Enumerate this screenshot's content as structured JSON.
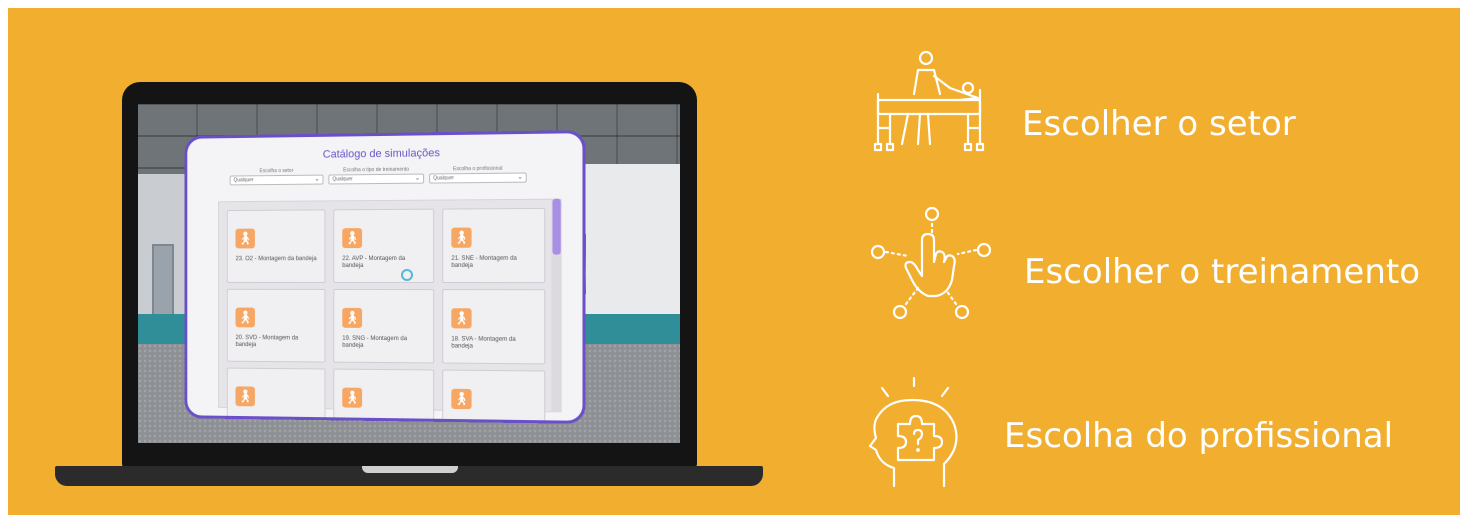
{
  "colors": {
    "background": "#f2ae2e",
    "accent_purple": "#6a4fc9",
    "card_icon": "#f7a764",
    "laptop": "#141414"
  },
  "catalog": {
    "title": "Catálogo de simulações",
    "filters": [
      {
        "label": "Escolha o setor",
        "value": "Qualquer"
      },
      {
        "label": "Escolha o tipo de treinamento",
        "value": "Qualquer"
      },
      {
        "label": "Escolha o profissional",
        "value": "Qualquer"
      }
    ],
    "cards": [
      {
        "label": "23. O2 - Montagem da bandeja",
        "icon": "walking-person-icon"
      },
      {
        "label": "22. AVP - Montagem da bandeja",
        "icon": "walking-person-icon"
      },
      {
        "label": "21. SNE - Montagem da bandeja",
        "icon": "walking-person-icon"
      },
      {
        "label": "20. SVD - Montagem da bandeja",
        "icon": "walking-person-icon"
      },
      {
        "label": "19. SNG - Montagem da bandeja",
        "icon": "walking-person-icon"
      },
      {
        "label": "18. SVA - Montagem da bandeja",
        "icon": "walking-person-icon"
      },
      {
        "label": "",
        "icon": "walking-person-icon"
      },
      {
        "label": "",
        "icon": "walking-person-icon"
      },
      {
        "label": "",
        "icon": "walking-person-icon"
      }
    ]
  },
  "features": [
    {
      "label": "Escolher o setor",
      "icon": "patient-bed-icon"
    },
    {
      "label": "Escolher o treinamento",
      "icon": "hand-touch-icon"
    },
    {
      "label": "Escolha do profissional",
      "icon": "head-puzzle-icon"
    }
  ]
}
